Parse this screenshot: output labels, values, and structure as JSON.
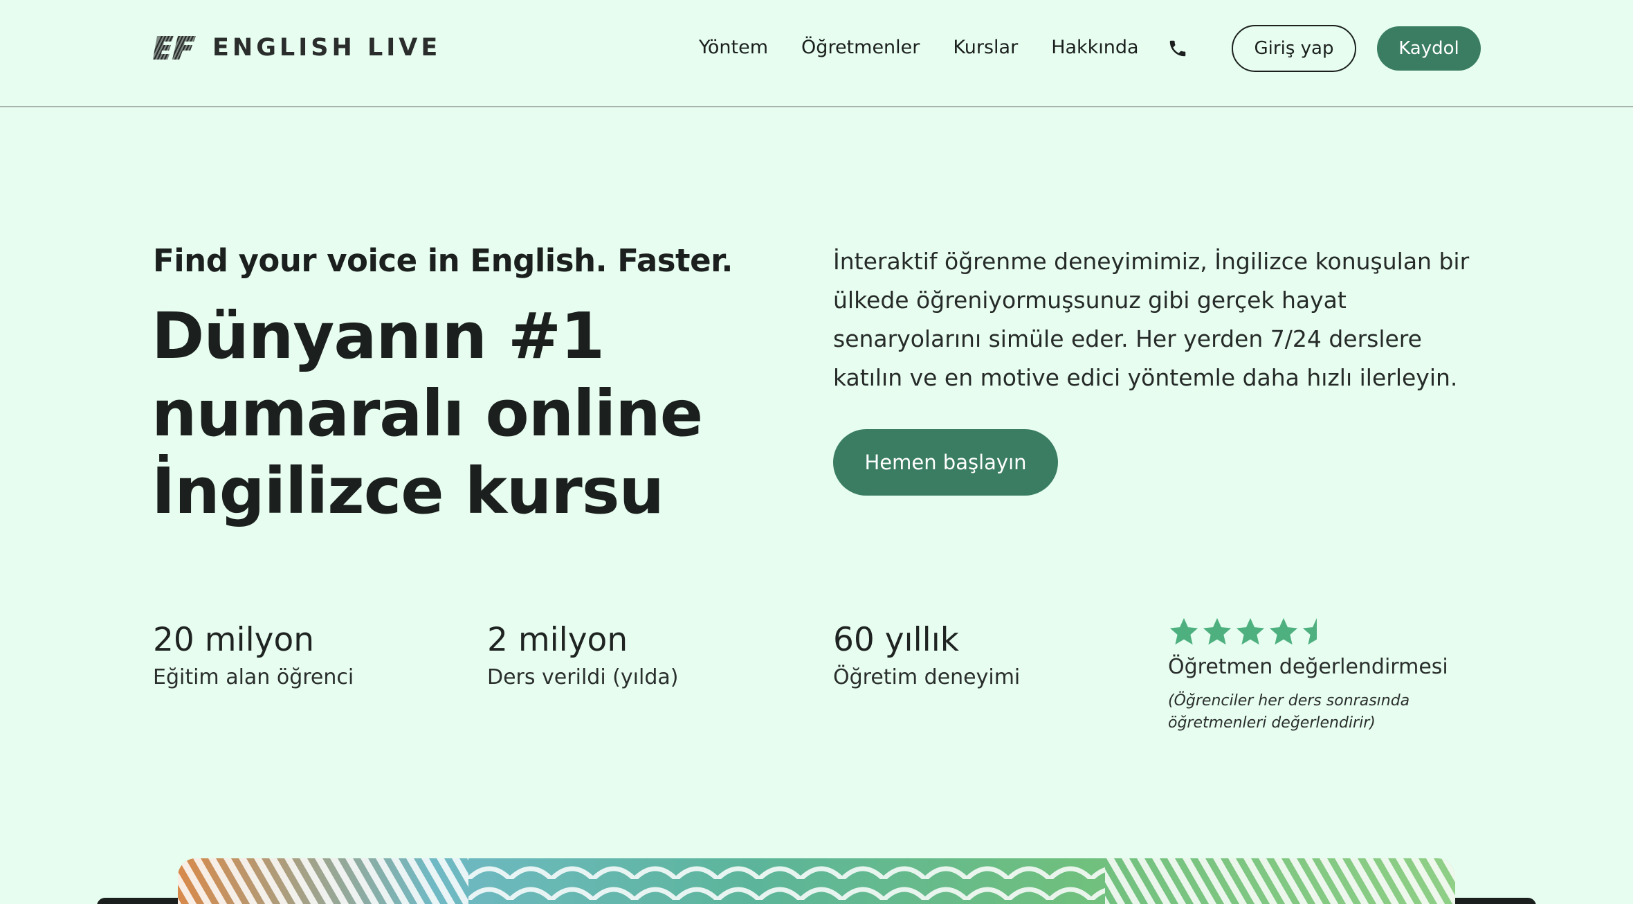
{
  "brand": {
    "name": "ENGLISH LIVE",
    "accent_color": "#3a7d62",
    "background_color": "#e6fdf0",
    "star_color": "#4fb07f"
  },
  "nav": {
    "items": [
      "Yöntem",
      "Öğretmenler",
      "Kurslar",
      "Hakkında"
    ],
    "phone_icon": "phone-icon",
    "login_label": "Giriş yap",
    "signup_label": "Kaydol"
  },
  "hero": {
    "tagline": "Find your voice in English. Faster.",
    "headline": "Dünyanın #1 numaralı online İngilizce kursu",
    "intro": "İnteraktif öğrenme deneyimimiz, İngilizce konuşulan bir ülkede öğreniyormuşsunuz gibi gerçek hayat senaryolarını simüle eder. Her yerden 7/24 derslere katılın ve en motive edici yöntemle daha hızlı ilerleyin.",
    "cta_label": "Hemen başlayın"
  },
  "stats": [
    {
      "value": "20 milyon",
      "label": "Eğitim alan öğrenci"
    },
    {
      "value": "2 milyon",
      "label": "Ders verildi (yılda)"
    },
    {
      "value": "60 yıllık",
      "label": "Öğretim deneyimi"
    }
  ],
  "rating": {
    "stars": 4.5,
    "max_stars": 5,
    "label": "Öğretmen değerlendirmesi",
    "note": "(Öğrenciler her ders sonrasında öğretmenleri değerlendirir)"
  }
}
